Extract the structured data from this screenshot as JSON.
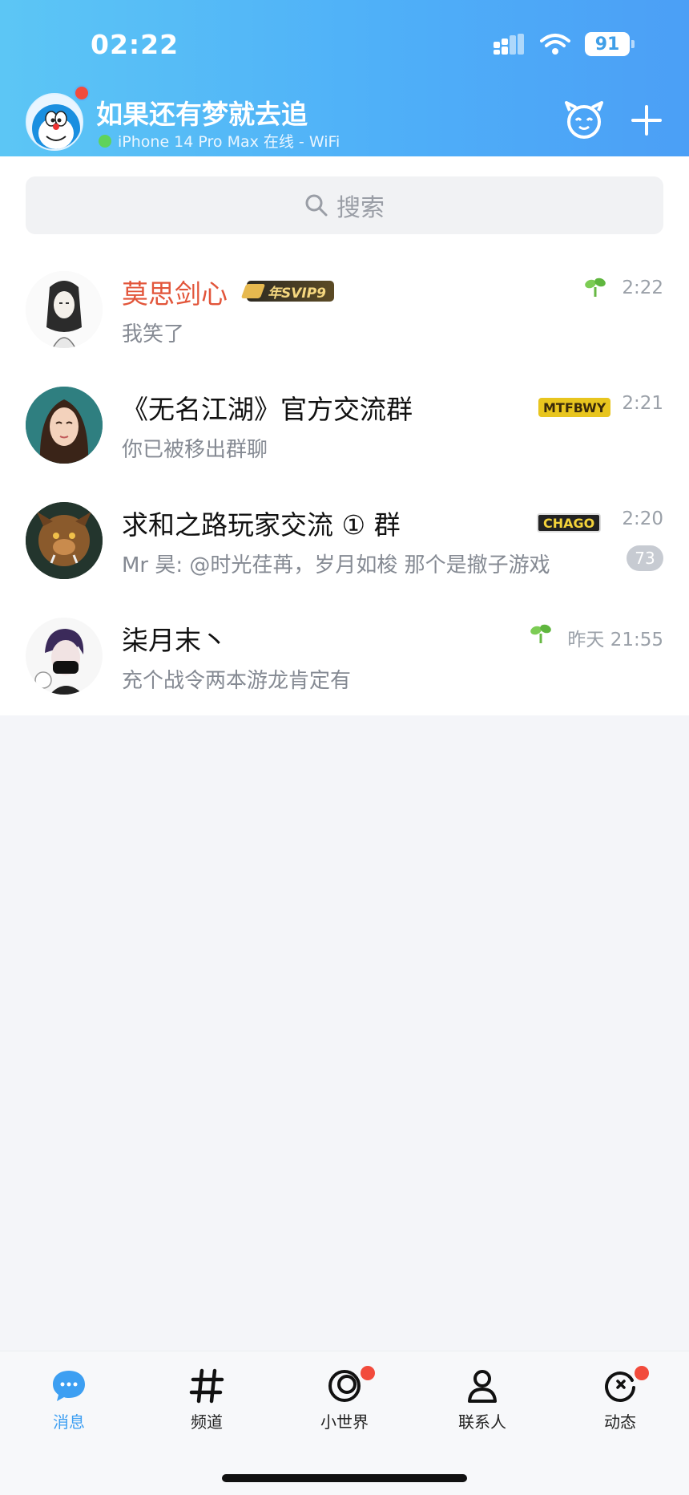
{
  "status_bar": {
    "time": "02:22",
    "battery": "91"
  },
  "header": {
    "nickname": "如果还有梦就去追",
    "online_status": "iPhone 14 Pro Max 在线 - WiFi"
  },
  "search": {
    "placeholder": "搜索"
  },
  "chats": [
    {
      "name": "莫思剑心",
      "message": "我笑了",
      "time": "2:22",
      "badge": "年SVIP9",
      "name_color": "#e2553a"
    },
    {
      "name": "《无名江湖》官方交流群",
      "message": "你已被移出群聊",
      "time": "2:21",
      "badge": "MTFBWY"
    },
    {
      "name": "求和之路玩家交流 ① 群",
      "message": "Mr 昊: @时光荏苒，岁月如梭 那个是撤子游戏",
      "time": "2:20",
      "badge": "CHAGO",
      "unread": "73"
    },
    {
      "name": "柒月末丶",
      "message": "充个战令两本游龙肯定有",
      "time": "昨天 21:55"
    }
  ],
  "tabs": [
    {
      "label": "消息",
      "icon": "message-icon",
      "active": true
    },
    {
      "label": "频道",
      "icon": "hash-icon"
    },
    {
      "label": "小世界",
      "icon": "world-icon",
      "dot": true
    },
    {
      "label": "联系人",
      "icon": "contacts-icon"
    },
    {
      "label": "动态",
      "icon": "activity-icon",
      "dot": true
    }
  ],
  "colors": {
    "accent": "#3d9ff2",
    "header_start": "#5cc6f5",
    "header_end": "#4b9ff6",
    "red_dot": "#f24b3c"
  }
}
